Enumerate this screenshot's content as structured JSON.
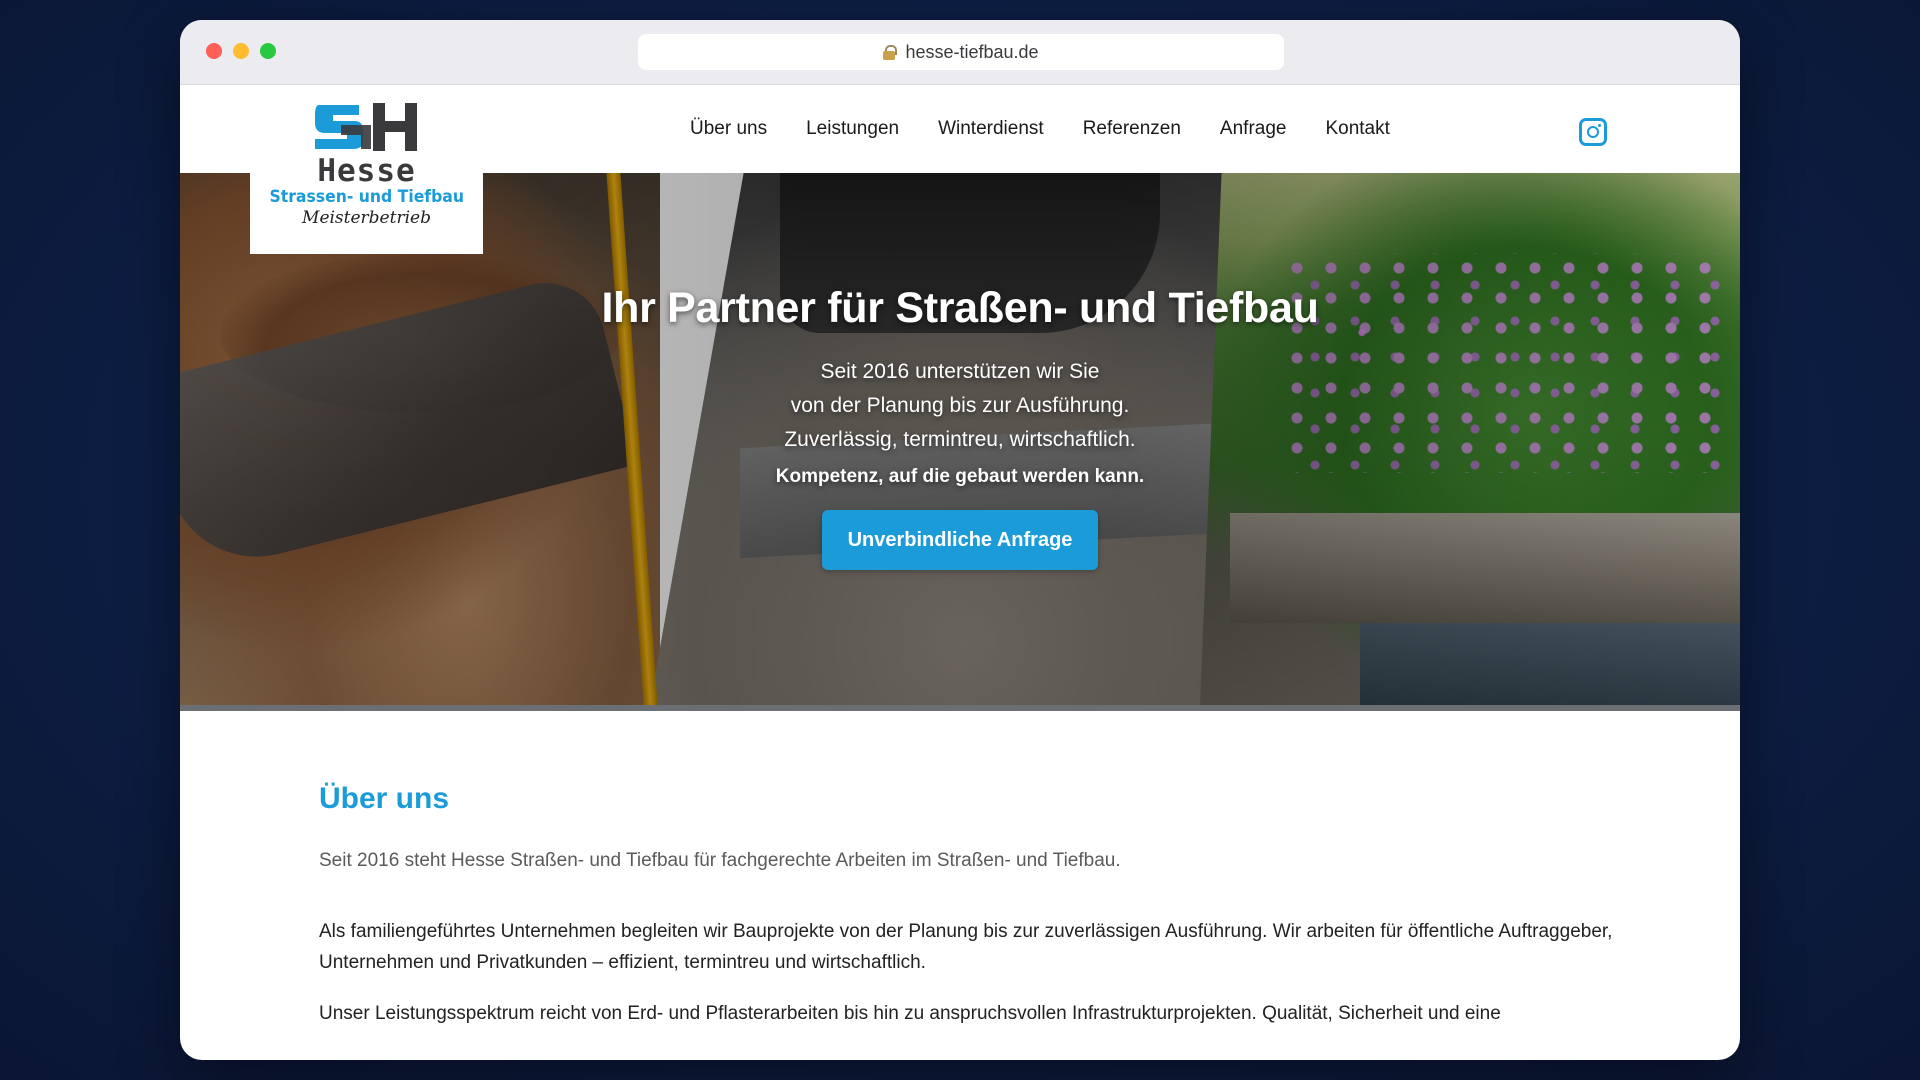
{
  "browser": {
    "url": "hesse-tiefbau.de"
  },
  "logo": {
    "name": "Hesse",
    "subtitle": "Strassen- und Tiefbau",
    "tagline": "Meisterbetrieb",
    "colors": {
      "blue": "#1b9bd8",
      "gray": "#3a3a3d"
    }
  },
  "nav": {
    "items": [
      "Über uns",
      "Leistungen",
      "Winterdienst",
      "Referenzen",
      "Anfrage",
      "Kontakt"
    ],
    "social_icon": "instagram-icon"
  },
  "hero": {
    "title": "Ihr Partner für Straßen- und Tiefbau",
    "lines": [
      "Seit 2016 unterstützen wir Sie",
      "von der Planung bis zur Ausführung.",
      "Zuverlässig, termintreu, wirtschaftlich."
    ],
    "strong": "Kompetenz, auf die gebaut werden kann.",
    "cta": "Unverbindliche Anfrage"
  },
  "about": {
    "title": "Über uns",
    "intro": "Seit 2016 steht Hesse Straßen- und Tiefbau für fachgerechte Arbeiten im Straßen- und Tiefbau.",
    "paragraph1": "Als familiengeführtes Unternehmen begleiten wir Bauprojekte von der Planung bis zur zuverlässigen Ausführung. Wir arbeiten für öffentliche Auftraggeber, Unternehmen und Privatkunden – effizient, termintreu und wirtschaftlich.",
    "paragraph2": "Unser Leistungsspektrum reicht von Erd- und Pflasterarbeiten bis hin zu anspruchsvollen Infrastrukturprojekten. Qualität, Sicherheit und eine"
  },
  "theme": {
    "accent": "#1b9bd8",
    "background": "#0e2048"
  }
}
